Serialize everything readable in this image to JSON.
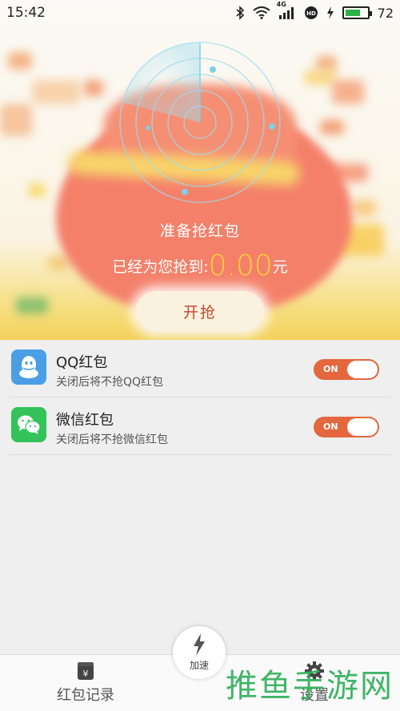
{
  "status_bar": {
    "time": "15:42",
    "network": "4G",
    "battery": "72",
    "battery_level": 0.72,
    "icons": [
      "bluetooth-icon",
      "wifi-icon",
      "signal-icon",
      "hd-icon",
      "charging-icon",
      "battery-icon"
    ]
  },
  "hero": {
    "title": "准备抢红包",
    "amount_prefix": "已经为您抢到:",
    "amount_value": "0.00",
    "amount_unit": "元",
    "start_button": "开抢"
  },
  "settings": [
    {
      "icon": "qq-icon",
      "title": "QQ红包",
      "subtitle": "关闭后将不抢QQ红包",
      "toggle": "ON",
      "color": "#4a9ee6"
    },
    {
      "icon": "wechat-icon",
      "title": "微信红包",
      "subtitle": "关闭后将不抢微信红包",
      "toggle": "ON",
      "color": "#33c35a"
    }
  ],
  "bottom_nav": {
    "records_label": "红包记录",
    "boost_label": "加速",
    "settings_label": "设置"
  },
  "watermark": "推鱼手游网",
  "colors": {
    "accent_red": "#e4673d",
    "amount_yellow": "#ffd333",
    "button_text": "#c9442d"
  }
}
